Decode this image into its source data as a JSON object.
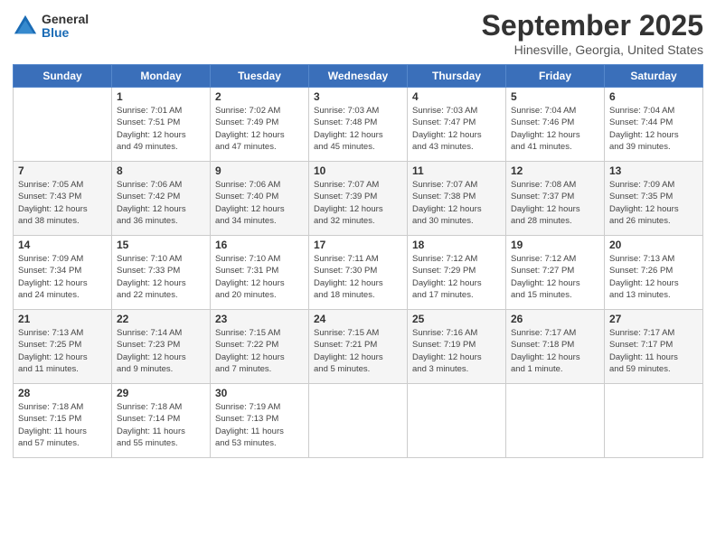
{
  "header": {
    "logo_general": "General",
    "logo_blue": "Blue",
    "title": "September 2025",
    "location": "Hinesville, Georgia, United States"
  },
  "days_of_week": [
    "Sunday",
    "Monday",
    "Tuesday",
    "Wednesday",
    "Thursday",
    "Friday",
    "Saturday"
  ],
  "weeks": [
    [
      {
        "day": "",
        "info": ""
      },
      {
        "day": "1",
        "info": "Sunrise: 7:01 AM\nSunset: 7:51 PM\nDaylight: 12 hours\nand 49 minutes."
      },
      {
        "day": "2",
        "info": "Sunrise: 7:02 AM\nSunset: 7:49 PM\nDaylight: 12 hours\nand 47 minutes."
      },
      {
        "day": "3",
        "info": "Sunrise: 7:03 AM\nSunset: 7:48 PM\nDaylight: 12 hours\nand 45 minutes."
      },
      {
        "day": "4",
        "info": "Sunrise: 7:03 AM\nSunset: 7:47 PM\nDaylight: 12 hours\nand 43 minutes."
      },
      {
        "day": "5",
        "info": "Sunrise: 7:04 AM\nSunset: 7:46 PM\nDaylight: 12 hours\nand 41 minutes."
      },
      {
        "day": "6",
        "info": "Sunrise: 7:04 AM\nSunset: 7:44 PM\nDaylight: 12 hours\nand 39 minutes."
      }
    ],
    [
      {
        "day": "7",
        "info": "Sunrise: 7:05 AM\nSunset: 7:43 PM\nDaylight: 12 hours\nand 38 minutes."
      },
      {
        "day": "8",
        "info": "Sunrise: 7:06 AM\nSunset: 7:42 PM\nDaylight: 12 hours\nand 36 minutes."
      },
      {
        "day": "9",
        "info": "Sunrise: 7:06 AM\nSunset: 7:40 PM\nDaylight: 12 hours\nand 34 minutes."
      },
      {
        "day": "10",
        "info": "Sunrise: 7:07 AM\nSunset: 7:39 PM\nDaylight: 12 hours\nand 32 minutes."
      },
      {
        "day": "11",
        "info": "Sunrise: 7:07 AM\nSunset: 7:38 PM\nDaylight: 12 hours\nand 30 minutes."
      },
      {
        "day": "12",
        "info": "Sunrise: 7:08 AM\nSunset: 7:37 PM\nDaylight: 12 hours\nand 28 minutes."
      },
      {
        "day": "13",
        "info": "Sunrise: 7:09 AM\nSunset: 7:35 PM\nDaylight: 12 hours\nand 26 minutes."
      }
    ],
    [
      {
        "day": "14",
        "info": "Sunrise: 7:09 AM\nSunset: 7:34 PM\nDaylight: 12 hours\nand 24 minutes."
      },
      {
        "day": "15",
        "info": "Sunrise: 7:10 AM\nSunset: 7:33 PM\nDaylight: 12 hours\nand 22 minutes."
      },
      {
        "day": "16",
        "info": "Sunrise: 7:10 AM\nSunset: 7:31 PM\nDaylight: 12 hours\nand 20 minutes."
      },
      {
        "day": "17",
        "info": "Sunrise: 7:11 AM\nSunset: 7:30 PM\nDaylight: 12 hours\nand 18 minutes."
      },
      {
        "day": "18",
        "info": "Sunrise: 7:12 AM\nSunset: 7:29 PM\nDaylight: 12 hours\nand 17 minutes."
      },
      {
        "day": "19",
        "info": "Sunrise: 7:12 AM\nSunset: 7:27 PM\nDaylight: 12 hours\nand 15 minutes."
      },
      {
        "day": "20",
        "info": "Sunrise: 7:13 AM\nSunset: 7:26 PM\nDaylight: 12 hours\nand 13 minutes."
      }
    ],
    [
      {
        "day": "21",
        "info": "Sunrise: 7:13 AM\nSunset: 7:25 PM\nDaylight: 12 hours\nand 11 minutes."
      },
      {
        "day": "22",
        "info": "Sunrise: 7:14 AM\nSunset: 7:23 PM\nDaylight: 12 hours\nand 9 minutes."
      },
      {
        "day": "23",
        "info": "Sunrise: 7:15 AM\nSunset: 7:22 PM\nDaylight: 12 hours\nand 7 minutes."
      },
      {
        "day": "24",
        "info": "Sunrise: 7:15 AM\nSunset: 7:21 PM\nDaylight: 12 hours\nand 5 minutes."
      },
      {
        "day": "25",
        "info": "Sunrise: 7:16 AM\nSunset: 7:19 PM\nDaylight: 12 hours\nand 3 minutes."
      },
      {
        "day": "26",
        "info": "Sunrise: 7:17 AM\nSunset: 7:18 PM\nDaylight: 12 hours\nand 1 minute."
      },
      {
        "day": "27",
        "info": "Sunrise: 7:17 AM\nSunset: 7:17 PM\nDaylight: 11 hours\nand 59 minutes."
      }
    ],
    [
      {
        "day": "28",
        "info": "Sunrise: 7:18 AM\nSunset: 7:15 PM\nDaylight: 11 hours\nand 57 minutes."
      },
      {
        "day": "29",
        "info": "Sunrise: 7:18 AM\nSunset: 7:14 PM\nDaylight: 11 hours\nand 55 minutes."
      },
      {
        "day": "30",
        "info": "Sunrise: 7:19 AM\nSunset: 7:13 PM\nDaylight: 11 hours\nand 53 minutes."
      },
      {
        "day": "",
        "info": ""
      },
      {
        "day": "",
        "info": ""
      },
      {
        "day": "",
        "info": ""
      },
      {
        "day": "",
        "info": ""
      }
    ]
  ]
}
